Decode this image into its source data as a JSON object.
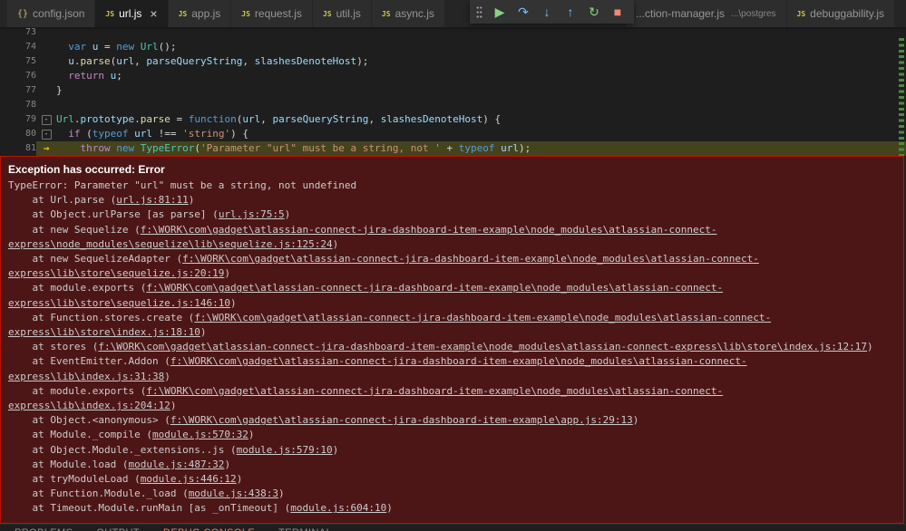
{
  "colors": {
    "editor_bg": "#1e1e1e",
    "tabbar_bg": "#252526",
    "tab_inactive_bg": "#2d2d2d",
    "tab_active_bg": "#1e1e1e",
    "exception_bg": "#4d1616",
    "exception_border": "#be1100",
    "current_line_bg": "#45431d",
    "ruler_mark": "#4a8a3f",
    "arrow": "#f0c200"
  },
  "token_colors": {
    "kw": "#569cd6",
    "ctl": "#c586c0",
    "cls": "#4ec9b0",
    "fn": "#dcdcaa",
    "vr": "#9cdcfe",
    "str": "#ce9178",
    "pun": "#d4d4d4"
  },
  "icons": {
    "js": "JS",
    "braces": "{}"
  },
  "tab_bar": {
    "groups": [
      {
        "tabs": [
          {
            "icon": "braces",
            "label": "config.json"
          },
          {
            "icon": "js",
            "label": "url.js",
            "active": true,
            "close": "×"
          },
          {
            "icon": "js",
            "label": "app.js"
          },
          {
            "icon": "js",
            "label": "request.js"
          },
          {
            "icon": "js",
            "label": "util.js"
          },
          {
            "icon": "js",
            "label": "async.js"
          }
        ]
      },
      {
        "tabs": [
          {
            "label": "...ction-manager.js",
            "desc": "...\\postgres"
          },
          {
            "icon": "js",
            "label": "debuggability.js"
          }
        ]
      }
    ]
  },
  "debug_toolbar": {
    "buttons": [
      {
        "name": "continue",
        "glyph": "▶",
        "color": "#89d185"
      },
      {
        "name": "step-over",
        "glyph": "↷",
        "color": "#75beff"
      },
      {
        "name": "step-into",
        "glyph": "↓",
        "color": "#75beff"
      },
      {
        "name": "step-out",
        "glyph": "↑",
        "color": "#75beff"
      },
      {
        "name": "restart",
        "glyph": "↻",
        "color": "#89d185"
      },
      {
        "name": "stop",
        "glyph": "■",
        "color": "#f48771"
      }
    ]
  },
  "editor": {
    "file": "url.js",
    "lines": [
      {
        "num": 73,
        "tokens": []
      },
      {
        "num": 74,
        "tokens": [
          [
            "pun",
            "  "
          ],
          [
            "kw",
            "var"
          ],
          [
            "pun",
            " "
          ],
          [
            "vr",
            "u"
          ],
          [
            "pun",
            " = "
          ],
          [
            "kw",
            "new"
          ],
          [
            "pun",
            " "
          ],
          [
            "cls",
            "Url"
          ],
          [
            "pun",
            "();"
          ]
        ]
      },
      {
        "num": 75,
        "tokens": [
          [
            "pun",
            "  "
          ],
          [
            "vr",
            "u"
          ],
          [
            "pun",
            "."
          ],
          [
            "fn",
            "parse"
          ],
          [
            "pun",
            "("
          ],
          [
            "vr",
            "url"
          ],
          [
            "pun",
            ", "
          ],
          [
            "vr",
            "parseQueryString"
          ],
          [
            "pun",
            ", "
          ],
          [
            "vr",
            "slashesDenoteHost"
          ],
          [
            "pun",
            ");"
          ]
        ]
      },
      {
        "num": 76,
        "tokens": [
          [
            "pun",
            "  "
          ],
          [
            "ctl",
            "return"
          ],
          [
            "pun",
            " "
          ],
          [
            "vr",
            "u"
          ],
          [
            "pun",
            ";"
          ]
        ]
      },
      {
        "num": 77,
        "tokens": [
          [
            "pun",
            "}"
          ]
        ]
      },
      {
        "num": 78,
        "tokens": []
      },
      {
        "num": 79,
        "fold": true,
        "tokens": [
          [
            "cls",
            "Url"
          ],
          [
            "pun",
            "."
          ],
          [
            "vr",
            "prototype"
          ],
          [
            "pun",
            "."
          ],
          [
            "fn",
            "parse"
          ],
          [
            "pun",
            " = "
          ],
          [
            "kw",
            "function"
          ],
          [
            "pun",
            "("
          ],
          [
            "vr",
            "url"
          ],
          [
            "pun",
            ", "
          ],
          [
            "vr",
            "parseQueryString"
          ],
          [
            "pun",
            ", "
          ],
          [
            "vr",
            "slashesDenoteHost"
          ],
          [
            "pun",
            ") {"
          ]
        ]
      },
      {
        "num": 80,
        "fold": true,
        "tokens": [
          [
            "pun",
            "  "
          ],
          [
            "ctl",
            "if"
          ],
          [
            "pun",
            " ("
          ],
          [
            "kw",
            "typeof"
          ],
          [
            "pun",
            " "
          ],
          [
            "vr",
            "url"
          ],
          [
            "pun",
            " !== "
          ],
          [
            "str",
            "'string'"
          ],
          [
            "pun",
            ") {"
          ]
        ]
      },
      {
        "num": 81,
        "current": true,
        "tokens": [
          [
            "pun",
            "    "
          ],
          [
            "ctl",
            "throw"
          ],
          [
            "pun",
            " "
          ],
          [
            "kw",
            "new"
          ],
          [
            "pun",
            " "
          ],
          [
            "cls",
            "TypeError"
          ],
          [
            "pun",
            "("
          ],
          [
            "str",
            "'Parameter \"url\" must be a string, not '"
          ],
          [
            "pun",
            " + "
          ],
          [
            "kw",
            "typeof"
          ],
          [
            "pun",
            " "
          ],
          [
            "vr",
            "url"
          ],
          [
            "pun",
            ");"
          ]
        ]
      }
    ]
  },
  "exception": {
    "title": "Exception has occurred: Error",
    "stack": [
      {
        "text": "TypeError: Parameter \"url\" must be a string, not undefined"
      },
      {
        "pre": "    at Url.parse (",
        "link": "url.js:81:11",
        "post": ")"
      },
      {
        "pre": "    at Object.urlParse [as parse] (",
        "link": "url.js:75:5",
        "post": ")"
      },
      {
        "pre": "    at new Sequelize (",
        "link": "f:\\WORK\\com\\gadget\\atlassian-connect-jira-dashboard-item-example\\node_modules\\atlassian-connect-express\\node_modules\\sequelize\\lib\\sequelize.js:125:24",
        "post": ")"
      },
      {
        "pre": "    at new SequelizeAdapter (",
        "link": "f:\\WORK\\com\\gadget\\atlassian-connect-jira-dashboard-item-example\\node_modules\\atlassian-connect-express\\lib\\store\\sequelize.js:20:19",
        "post": ")"
      },
      {
        "pre": "    at module.exports (",
        "link": "f:\\WORK\\com\\gadget\\atlassian-connect-jira-dashboard-item-example\\node_modules\\atlassian-connect-express\\lib\\store\\sequelize.js:146:10",
        "post": ")"
      },
      {
        "pre": "    at Function.stores.create (",
        "link": "f:\\WORK\\com\\gadget\\atlassian-connect-jira-dashboard-item-example\\node_modules\\atlassian-connect-express\\lib\\store\\index.js:18:10",
        "post": ")"
      },
      {
        "pre": "    at stores (",
        "link": "f:\\WORK\\com\\gadget\\atlassian-connect-jira-dashboard-item-example\\node_modules\\atlassian-connect-express\\lib\\store\\index.js:12:17",
        "post": ")"
      },
      {
        "pre": "    at EventEmitter.Addon (",
        "link": "f:\\WORK\\com\\gadget\\atlassian-connect-jira-dashboard-item-example\\node_modules\\atlassian-connect-express\\lib\\index.js:31:38",
        "post": ")"
      },
      {
        "pre": "    at module.exports (",
        "link": "f:\\WORK\\com\\gadget\\atlassian-connect-jira-dashboard-item-example\\node_modules\\atlassian-connect-express\\lib\\index.js:204:12",
        "post": ")"
      },
      {
        "pre": "    at Object.<anonymous> (",
        "link": "f:\\WORK\\com\\gadget\\atlassian-connect-jira-dashboard-item-example\\app.js:29:13",
        "post": ")"
      },
      {
        "pre": "    at Module._compile (",
        "link": "module.js:570:32",
        "post": ")"
      },
      {
        "pre": "    at Object.Module._extensions..js (",
        "link": "module.js:579:10",
        "post": ")"
      },
      {
        "pre": "    at Module.load (",
        "link": "module.js:487:32",
        "post": ")"
      },
      {
        "pre": "    at tryModuleLoad (",
        "link": "module.js:446:12",
        "post": ")"
      },
      {
        "pre": "    at Function.Module._load (",
        "link": "module.js:438:3",
        "post": ")"
      },
      {
        "pre": "    at Timeout.Module.runMain [as _onTimeout] (",
        "link": "module.js:604:10",
        "post": ")"
      }
    ]
  },
  "panel": {
    "tabs": [
      {
        "label": "PROBLEMS"
      },
      {
        "label": "OUTPUT"
      },
      {
        "label": "DEBUG CONSOLE",
        "active": true
      },
      {
        "label": "TERMINAL"
      }
    ]
  }
}
